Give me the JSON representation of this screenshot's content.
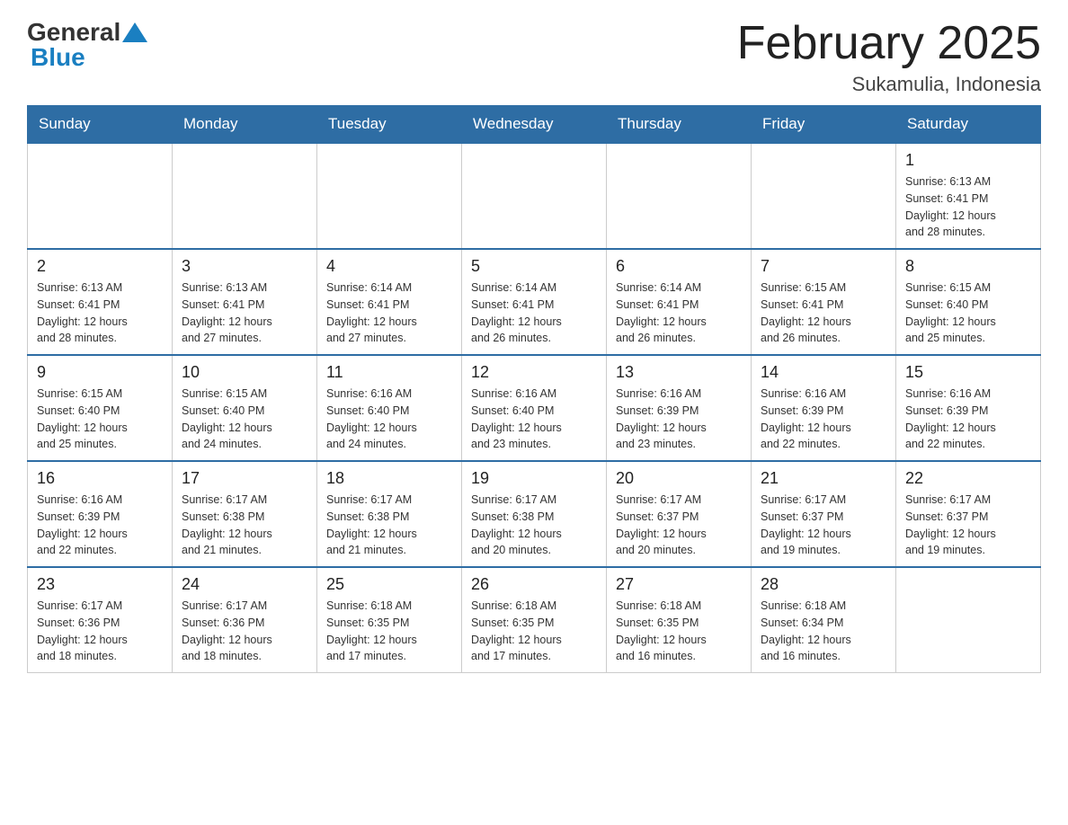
{
  "header": {
    "logo_general": "General",
    "logo_blue": "Blue",
    "month_title": "February 2025",
    "location": "Sukamulia, Indonesia"
  },
  "weekdays": [
    "Sunday",
    "Monday",
    "Tuesday",
    "Wednesday",
    "Thursday",
    "Friday",
    "Saturday"
  ],
  "weeks": [
    {
      "days": [
        {
          "num": "",
          "info": ""
        },
        {
          "num": "",
          "info": ""
        },
        {
          "num": "",
          "info": ""
        },
        {
          "num": "",
          "info": ""
        },
        {
          "num": "",
          "info": ""
        },
        {
          "num": "",
          "info": ""
        },
        {
          "num": "1",
          "info": "Sunrise: 6:13 AM\nSunset: 6:41 PM\nDaylight: 12 hours\nand 28 minutes."
        }
      ]
    },
    {
      "days": [
        {
          "num": "2",
          "info": "Sunrise: 6:13 AM\nSunset: 6:41 PM\nDaylight: 12 hours\nand 28 minutes."
        },
        {
          "num": "3",
          "info": "Sunrise: 6:13 AM\nSunset: 6:41 PM\nDaylight: 12 hours\nand 27 minutes."
        },
        {
          "num": "4",
          "info": "Sunrise: 6:14 AM\nSunset: 6:41 PM\nDaylight: 12 hours\nand 27 minutes."
        },
        {
          "num": "5",
          "info": "Sunrise: 6:14 AM\nSunset: 6:41 PM\nDaylight: 12 hours\nand 26 minutes."
        },
        {
          "num": "6",
          "info": "Sunrise: 6:14 AM\nSunset: 6:41 PM\nDaylight: 12 hours\nand 26 minutes."
        },
        {
          "num": "7",
          "info": "Sunrise: 6:15 AM\nSunset: 6:41 PM\nDaylight: 12 hours\nand 26 minutes."
        },
        {
          "num": "8",
          "info": "Sunrise: 6:15 AM\nSunset: 6:40 PM\nDaylight: 12 hours\nand 25 minutes."
        }
      ]
    },
    {
      "days": [
        {
          "num": "9",
          "info": "Sunrise: 6:15 AM\nSunset: 6:40 PM\nDaylight: 12 hours\nand 25 minutes."
        },
        {
          "num": "10",
          "info": "Sunrise: 6:15 AM\nSunset: 6:40 PM\nDaylight: 12 hours\nand 24 minutes."
        },
        {
          "num": "11",
          "info": "Sunrise: 6:16 AM\nSunset: 6:40 PM\nDaylight: 12 hours\nand 24 minutes."
        },
        {
          "num": "12",
          "info": "Sunrise: 6:16 AM\nSunset: 6:40 PM\nDaylight: 12 hours\nand 23 minutes."
        },
        {
          "num": "13",
          "info": "Sunrise: 6:16 AM\nSunset: 6:39 PM\nDaylight: 12 hours\nand 23 minutes."
        },
        {
          "num": "14",
          "info": "Sunrise: 6:16 AM\nSunset: 6:39 PM\nDaylight: 12 hours\nand 22 minutes."
        },
        {
          "num": "15",
          "info": "Sunrise: 6:16 AM\nSunset: 6:39 PM\nDaylight: 12 hours\nand 22 minutes."
        }
      ]
    },
    {
      "days": [
        {
          "num": "16",
          "info": "Sunrise: 6:16 AM\nSunset: 6:39 PM\nDaylight: 12 hours\nand 22 minutes."
        },
        {
          "num": "17",
          "info": "Sunrise: 6:17 AM\nSunset: 6:38 PM\nDaylight: 12 hours\nand 21 minutes."
        },
        {
          "num": "18",
          "info": "Sunrise: 6:17 AM\nSunset: 6:38 PM\nDaylight: 12 hours\nand 21 minutes."
        },
        {
          "num": "19",
          "info": "Sunrise: 6:17 AM\nSunset: 6:38 PM\nDaylight: 12 hours\nand 20 minutes."
        },
        {
          "num": "20",
          "info": "Sunrise: 6:17 AM\nSunset: 6:37 PM\nDaylight: 12 hours\nand 20 minutes."
        },
        {
          "num": "21",
          "info": "Sunrise: 6:17 AM\nSunset: 6:37 PM\nDaylight: 12 hours\nand 19 minutes."
        },
        {
          "num": "22",
          "info": "Sunrise: 6:17 AM\nSunset: 6:37 PM\nDaylight: 12 hours\nand 19 minutes."
        }
      ]
    },
    {
      "days": [
        {
          "num": "23",
          "info": "Sunrise: 6:17 AM\nSunset: 6:36 PM\nDaylight: 12 hours\nand 18 minutes."
        },
        {
          "num": "24",
          "info": "Sunrise: 6:17 AM\nSunset: 6:36 PM\nDaylight: 12 hours\nand 18 minutes."
        },
        {
          "num": "25",
          "info": "Sunrise: 6:18 AM\nSunset: 6:35 PM\nDaylight: 12 hours\nand 17 minutes."
        },
        {
          "num": "26",
          "info": "Sunrise: 6:18 AM\nSunset: 6:35 PM\nDaylight: 12 hours\nand 17 minutes."
        },
        {
          "num": "27",
          "info": "Sunrise: 6:18 AM\nSunset: 6:35 PM\nDaylight: 12 hours\nand 16 minutes."
        },
        {
          "num": "28",
          "info": "Sunrise: 6:18 AM\nSunset: 6:34 PM\nDaylight: 12 hours\nand 16 minutes."
        },
        {
          "num": "",
          "info": ""
        }
      ]
    }
  ]
}
